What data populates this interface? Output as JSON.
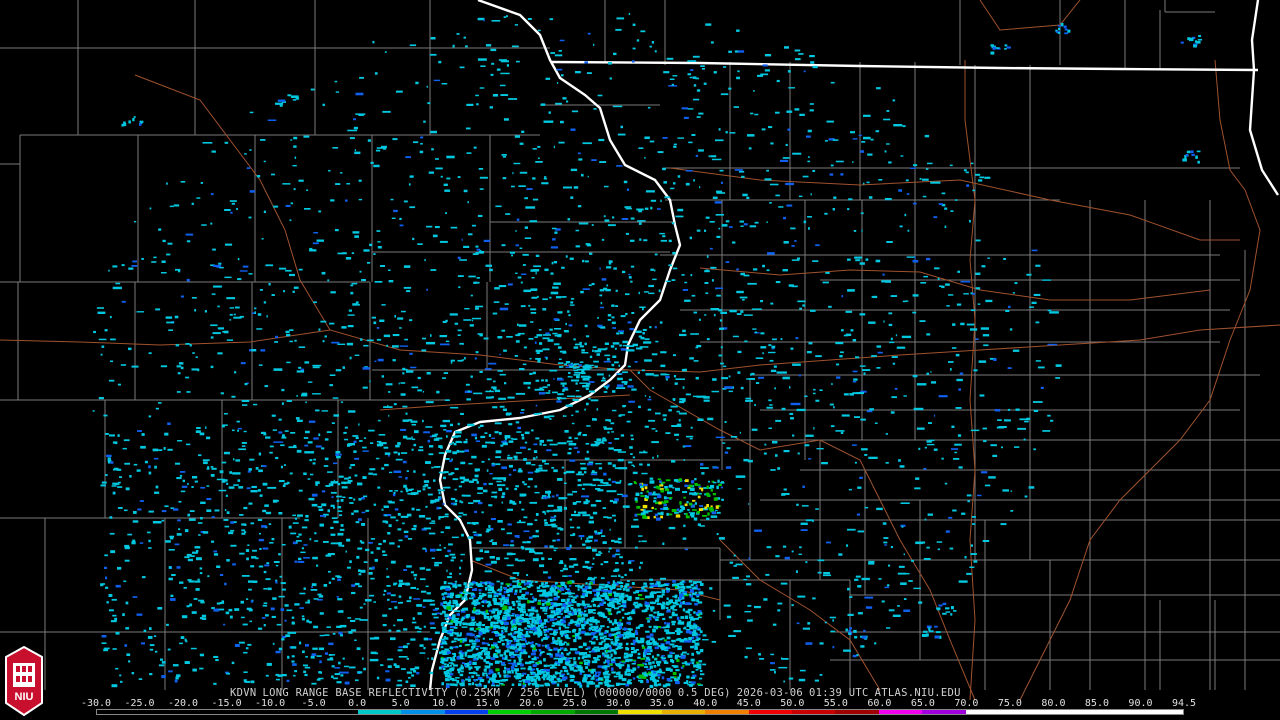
{
  "caption": {
    "station": "KDVN",
    "product": "LONG RANGE BASE REFLECTIVITY",
    "resolution": "(0.25KM / 256 LEVEL)",
    "volume": "(000000/0000",
    "elevation": "0.5 DEG)",
    "date": "2026-03-06",
    "time": "01:39 UTC",
    "source": "ATLAS.NIU.EDU"
  },
  "logo": {
    "text": "NIU",
    "colors": {
      "red": "#c8102e",
      "white": "#ffffff",
      "black": "#000000"
    }
  },
  "scale": {
    "labels": [
      "-30.0",
      "-25.0",
      "-20.0",
      "-15.0",
      "-10.0",
      "-5.0",
      "0.0",
      "5.0",
      "10.0",
      "15.0",
      "20.0",
      "25.0",
      "30.0",
      "35.0",
      "40.0",
      "45.0",
      "50.0",
      "55.0",
      "60.0",
      "65.0",
      "70.0",
      "75.0",
      "80.0",
      "85.0",
      "90.0",
      "94.5"
    ],
    "colors": [
      "#000000",
      "#000000",
      "#000000",
      "#000000",
      "#000000",
      "#000000",
      "#00c8c8",
      "#0090e8",
      "#0040f0",
      "#00d000",
      "#00a800",
      "#007800",
      "#f0e000",
      "#e8b000",
      "#f08000",
      "#f00000",
      "#c80000",
      "#a00000",
      "#f000f0",
      "#a000e0",
      "#ffffff",
      "#ffffff",
      "#ffffff",
      "#ffffff",
      "#ffffff"
    ]
  },
  "map_colors": {
    "background": "#000000",
    "county_lines": "#7a7a7a",
    "state_lines": "#ffffff",
    "highways": "#a0522d",
    "echo_low": "#00c8e0",
    "echo_mid": "#1060f0",
    "echo_high": "#f0e000",
    "echo_green": "#00c000"
  }
}
